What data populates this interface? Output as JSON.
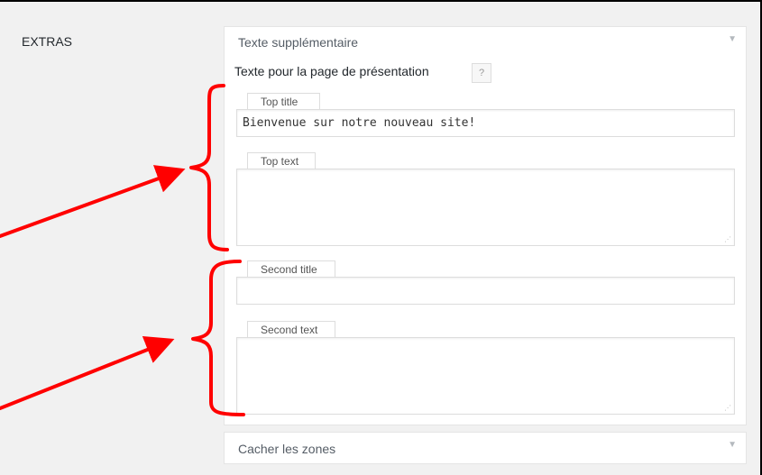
{
  "section": {
    "label": "EXTRAS"
  },
  "panel_extra": {
    "title": "Texte supplémentaire",
    "description": "Texte pour la page de présentation",
    "help_label": "?",
    "fields": [
      {
        "label": "Top title",
        "type": "text",
        "value": "Bienvenue sur notre nouveau site!"
      },
      {
        "label": "Top text",
        "type": "textarea",
        "value": ""
      },
      {
        "label": "Second title",
        "type": "text",
        "value": ""
      },
      {
        "label": "Second text",
        "type": "textarea",
        "value": ""
      }
    ]
  },
  "panel_hide": {
    "title": "Cacher les zones"
  },
  "icons": {
    "toggle": "triangle-down-icon",
    "resize": "resize-grip-icon"
  },
  "annotation_color": "#ff0000"
}
